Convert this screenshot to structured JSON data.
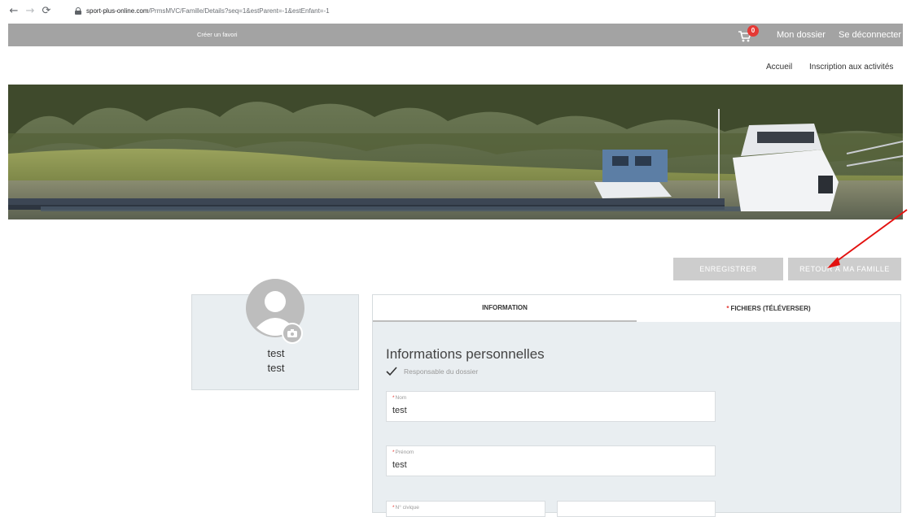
{
  "browser": {
    "url_domain": "sport-plus-online.com",
    "url_path": "/PrmsMVC/Famille/Details?seq=1&estParent=-1&estEnfant=-1"
  },
  "top_bar": {
    "favori_label": "Créer un favori",
    "cart_count": "0",
    "mon_dossier": "Mon dossier",
    "logout": "Se déconnecter"
  },
  "sub_nav": {
    "accueil": "Accueil",
    "inscription": "Inscription aux activités"
  },
  "actions": {
    "save_label": "Enregistrer",
    "back_label": "Retour à ma famille"
  },
  "profile": {
    "line1": "test",
    "line2": "test"
  },
  "tabs": [
    {
      "label": "Information",
      "required": false,
      "active": true
    },
    {
      "label": "Fichiers (Téléverser)",
      "required": true,
      "active": false
    }
  ],
  "form": {
    "section_title": "Informations personnelles",
    "responsable_label": "Responsable du dossier",
    "responsable_checked": true,
    "required_mark": "*",
    "nom_label": "Nom",
    "nom_value": "test",
    "prenom_label": "Prénom",
    "prenom_value": "test",
    "civique_label": "N° civique",
    "civique_value": ""
  },
  "colors": {
    "top_bar": "#a3a3a3",
    "badge": "#e53935",
    "button": "#cdcdcd",
    "panel_bg": "#e9eef1",
    "annotation_arrow": "#e3110f"
  }
}
